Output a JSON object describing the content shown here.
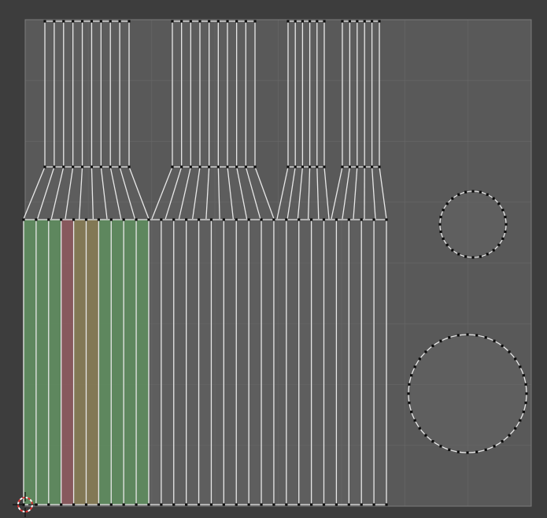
{
  "editor": {
    "type": "UV Editor",
    "background_color": "#3d3d3d",
    "uv_area_color": "#595959",
    "grid_line_color": "#6a6a6a",
    "edge_color": "#e8e8e8",
    "vertex_color": "#0a0a0a",
    "face_color": "#666666",
    "selected_face_colors": {
      "green": "#5f8a5f",
      "red": "#8a5a5e",
      "olive": "#857a55"
    },
    "cursor_icon": "2d-cursor-icon",
    "islands": [
      {
        "name": "long-strip-island",
        "icon": "uv-island"
      },
      {
        "name": "top-strip-group-a",
        "icon": "uv-island"
      },
      {
        "name": "top-strip-group-b",
        "icon": "uv-island"
      },
      {
        "name": "top-strip-group-c",
        "icon": "uv-island"
      },
      {
        "name": "top-strip-group-d",
        "icon": "uv-island"
      },
      {
        "name": "small-circle-island",
        "icon": "uv-island"
      },
      {
        "name": "large-circle-island",
        "icon": "uv-island"
      }
    ]
  }
}
